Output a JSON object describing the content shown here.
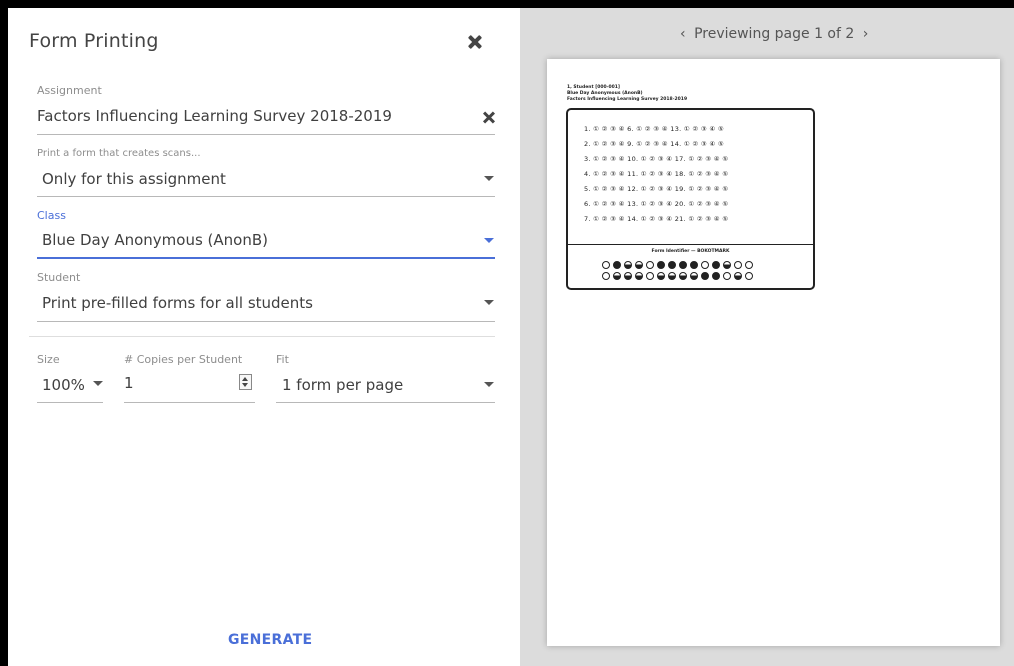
{
  "dialog": {
    "title": "Form Printing"
  },
  "assignment": {
    "label": "Assignment",
    "value": "Factors Influencing Learning Survey 2018-2019"
  },
  "scope": {
    "label": "Print a form that creates scans...",
    "value": "Only for this assignment"
  },
  "class": {
    "label": "Class",
    "value": "Blue Day Anonymous (AnonB)"
  },
  "student": {
    "label": "Student",
    "value": "Print pre-filled forms for all students"
  },
  "size": {
    "label": "Size",
    "value": "100%"
  },
  "copies": {
    "label": "# Copies per Student",
    "value": "1"
  },
  "fit": {
    "label": "Fit",
    "value": "1 form per page"
  },
  "generate_label": "GENERATE",
  "preview": {
    "pager_text": "Previewing page 1 of 2",
    "prev_icon": "chevron-left-icon",
    "next_icon": "chevron-right-icon",
    "header_lines": [
      "1, Student [000-001]",
      "Blue Day Anonymous (AnonB)",
      "Factors Influencing Learning Survey 2018-2019"
    ],
    "question_rows": [
      "1. ① ② ③ ④      6. ① ② ③ ④      13. ① ② ③ ④ ⑤",
      "2. ① ② ③ ④      9. ① ② ③ ④      14. ① ② ③ ④ ⑤",
      "3. ① ② ③ ④     10. ① ② ③ ④     17. ① ② ③ ④ ⑤",
      "4. ① ② ③ ④     11. ① ② ③ ④     18. ① ② ③ ④ ⑤",
      "5. ① ② ③ ④     12. ① ② ③ ④     19. ① ② ③ ④ ⑤",
      "6. ① ② ③ ④     13. ① ② ③ ④     20. ① ② ③ ④ ⑤",
      "7. ① ② ③ ④     14. ① ② ③ ④     21. ① ② ③ ④ ⑤"
    ],
    "form_identifier": "Form Identifier — BOKOTMARK",
    "bubble_rows": [
      "ofhhoffffofhoo",
      "ohhhohhhhffoho"
    ]
  },
  "colors": {
    "accent": "#4a6fd8",
    "panel_bg": "#dcdcdc"
  }
}
